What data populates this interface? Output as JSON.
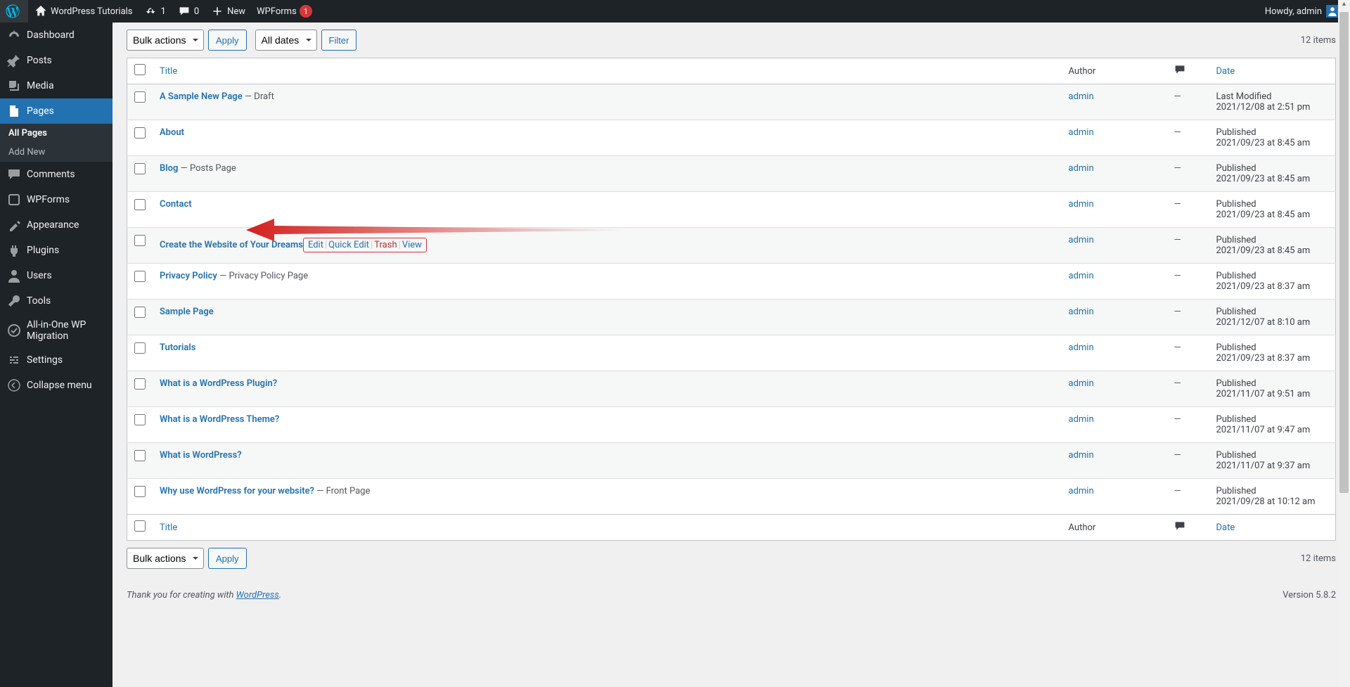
{
  "adminbar": {
    "site_title": "WordPress Tutorials",
    "updates": "1",
    "comments": "0",
    "new": "New",
    "wpforms": "WPForms",
    "wpforms_badge": "1",
    "howdy": "Howdy, admin"
  },
  "sidebar": {
    "items": [
      {
        "label": "Dashboard",
        "icon": "dashboard"
      },
      {
        "label": "Posts",
        "icon": "pin"
      },
      {
        "label": "Media",
        "icon": "media"
      },
      {
        "label": "Pages",
        "icon": "page",
        "current": true,
        "sub": [
          {
            "label": "All Pages",
            "active": true
          },
          {
            "label": "Add New",
            "active": false
          }
        ]
      },
      {
        "label": "Comments",
        "icon": "comment"
      },
      {
        "label": "WPForms",
        "icon": "wpforms"
      },
      {
        "label": "Appearance",
        "icon": "appearance"
      },
      {
        "label": "Plugins",
        "icon": "plugin"
      },
      {
        "label": "Users",
        "icon": "user"
      },
      {
        "label": "Tools",
        "icon": "tools"
      },
      {
        "label": "All-in-One WP Migration",
        "icon": "migration"
      },
      {
        "label": "Settings",
        "icon": "settings"
      },
      {
        "label": "Collapse menu",
        "icon": "collapse"
      }
    ]
  },
  "tablenav": {
    "bulk_actions": "Bulk actions",
    "apply": "Apply",
    "all_dates": "All dates",
    "filter": "Filter",
    "count": "12 items"
  },
  "table": {
    "columns": {
      "title": "Title",
      "author": "Author",
      "date": "Date"
    },
    "rows": [
      {
        "title": "A Sample New Page",
        "suffix": " — Draft",
        "author": "admin",
        "status": "Last Modified",
        "date": "2021/12/08 at 2:51 pm",
        "highlight": false
      },
      {
        "title": "About",
        "suffix": "",
        "author": "admin",
        "status": "Published",
        "date": "2021/09/23 at 8:45 am",
        "highlight": false
      },
      {
        "title": "Blog",
        "suffix": " — Posts Page",
        "author": "admin",
        "status": "Published",
        "date": "2021/09/23 at 8:45 am",
        "highlight": false
      },
      {
        "title": "Contact",
        "suffix": "",
        "author": "admin",
        "status": "Published",
        "date": "2021/09/23 at 8:45 am",
        "highlight": false
      },
      {
        "title": "Create the Website of Your Dreams",
        "suffix": "",
        "author": "admin",
        "status": "Published",
        "date": "2021/09/23 at 8:45 am",
        "highlight": true
      },
      {
        "title": "Privacy Policy",
        "suffix": " — Privacy Policy Page",
        "author": "admin",
        "status": "Published",
        "date": "2021/09/23 at 8:37 am",
        "highlight": false
      },
      {
        "title": "Sample Page",
        "suffix": "",
        "author": "admin",
        "status": "Published",
        "date": "2021/12/07 at 8:10 am",
        "highlight": false
      },
      {
        "title": "Tutorials",
        "suffix": "",
        "author": "admin",
        "status": "Published",
        "date": "2021/09/23 at 8:37 am",
        "highlight": false
      },
      {
        "title": "What is a WordPress Plugin?",
        "suffix": "",
        "author": "admin",
        "status": "Published",
        "date": "2021/11/07 at 9:51 am",
        "highlight": false
      },
      {
        "title": "What is a WordPress Theme?",
        "suffix": "",
        "author": "admin",
        "status": "Published",
        "date": "2021/11/07 at 9:47 am",
        "highlight": false
      },
      {
        "title": "What is WordPress?",
        "suffix": "",
        "author": "admin",
        "status": "Published",
        "date": "2021/11/07 at 9:37 am",
        "highlight": false
      },
      {
        "title": "Why use WordPress for your website?",
        "suffix": " — Front Page",
        "author": "admin",
        "status": "Published",
        "date": "2021/09/28 at 10:12 am",
        "highlight": false
      }
    ]
  },
  "row_actions": {
    "edit": "Edit",
    "quick_edit": "Quick Edit",
    "trash": "Trash",
    "view": "View"
  },
  "footer": {
    "thanks": "Thank you for creating with ",
    "wp": "WordPress",
    "dot": ".",
    "version": "Version 5.8.2"
  }
}
